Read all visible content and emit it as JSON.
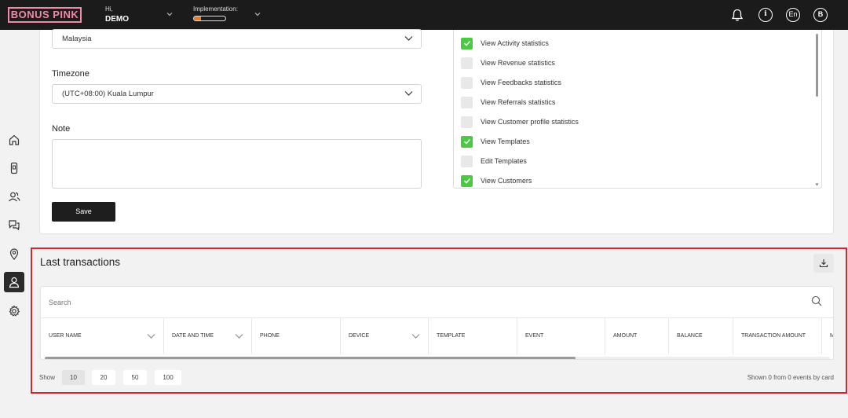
{
  "header": {
    "logo": "BONUS PINK",
    "greeting": "Hi,",
    "user_name": "DEMO",
    "implementation_label": "Implementation:",
    "implementation_progress": 0.22,
    "language": "En",
    "avatar_letter": "B",
    "info_glyph": "i"
  },
  "sidebar": {
    "items": [
      {
        "name": "home-icon",
        "active": false
      },
      {
        "name": "device-icon",
        "active": false
      },
      {
        "name": "users-icon",
        "active": false
      },
      {
        "name": "chat-icon",
        "active": false
      },
      {
        "name": "location-icon",
        "active": false
      },
      {
        "name": "user-icon",
        "active": true
      },
      {
        "name": "gear-icon",
        "active": false
      }
    ]
  },
  "form": {
    "country_value": "Malaysia",
    "timezone_label": "Timezone",
    "timezone_value": "(UTC+08:00) Kuala Lumpur",
    "note_label": "Note",
    "save_label": "Save"
  },
  "permissions": [
    {
      "label": "View Activity statistics",
      "checked": true
    },
    {
      "label": "View Revenue statistics",
      "checked": false
    },
    {
      "label": "View Feedbacks statistics",
      "checked": false
    },
    {
      "label": "View Referrals statistics",
      "checked": false
    },
    {
      "label": "View Customer profile statistics",
      "checked": false
    },
    {
      "label": "View Templates",
      "checked": true
    },
    {
      "label": "Edit Templates",
      "checked": false
    },
    {
      "label": "View Customers",
      "checked": true
    }
  ],
  "transactions": {
    "title": "Last transactions",
    "search_placeholder": "Search",
    "columns": [
      "USER NAME",
      "DATE AND TIME",
      "PHONE",
      "DEVICE",
      "TEMPLATE",
      "EVENT",
      "AMOUNT",
      "BALANCE",
      "TRANSACTION AMOUNT",
      "M"
    ],
    "show_label": "Show",
    "page_sizes": [
      "10",
      "20",
      "50",
      "100"
    ],
    "active_page_size": "10",
    "shown_text": "Shown 0 from 0 events by card"
  },
  "colors": {
    "accent_pink": "#f08aa6",
    "check_green": "#4cc943",
    "highlight_red": "#d42828",
    "progress_orange": "#f07c1d"
  }
}
